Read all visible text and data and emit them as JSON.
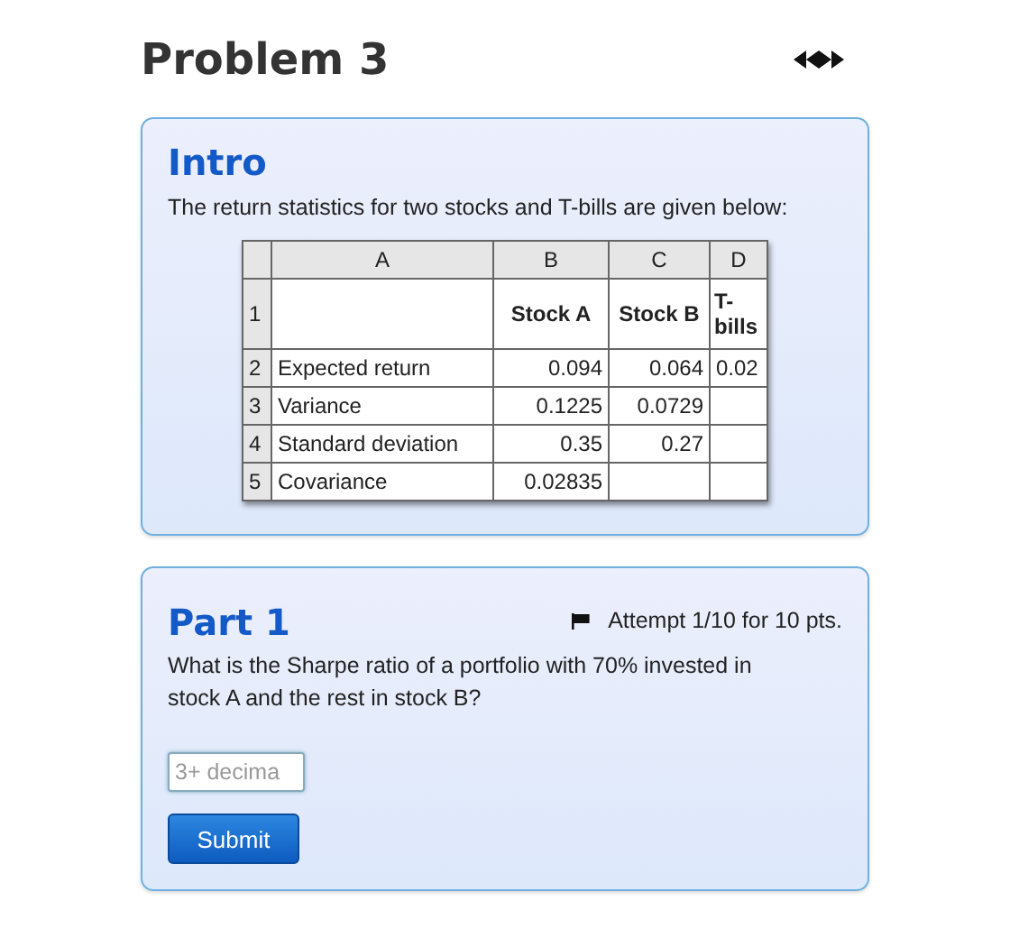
{
  "title": "Problem 3",
  "intro": {
    "heading": "Intro",
    "text": "The return statistics for two stocks and T-bills are given below:",
    "table": {
      "columns": [
        "A",
        "B",
        "C",
        "D"
      ],
      "rows": [
        {
          "number": "1",
          "cells": [
            "",
            "Stock A",
            "Stock B",
            "T-bills"
          ]
        },
        {
          "number": "2",
          "cells": [
            "Expected return",
            "0.094",
            "0.064",
            "0.02"
          ]
        },
        {
          "number": "3",
          "cells": [
            "Variance",
            "0.1225",
            "0.0729",
            ""
          ]
        },
        {
          "number": "4",
          "cells": [
            "Standard deviation",
            "0.35",
            "0.27",
            ""
          ]
        },
        {
          "number": "5",
          "cells": [
            "Covariance",
            "0.02835",
            "",
            ""
          ]
        }
      ]
    }
  },
  "part": {
    "heading": "Part 1",
    "attempt": "Attempt 1/10 for 10 pts.",
    "question": "What is the Sharpe ratio of a portfolio with 70% invested in stock A and the rest in stock B?",
    "answer": {
      "placeholder": "3+ decima"
    },
    "button": "Submit"
  }
}
